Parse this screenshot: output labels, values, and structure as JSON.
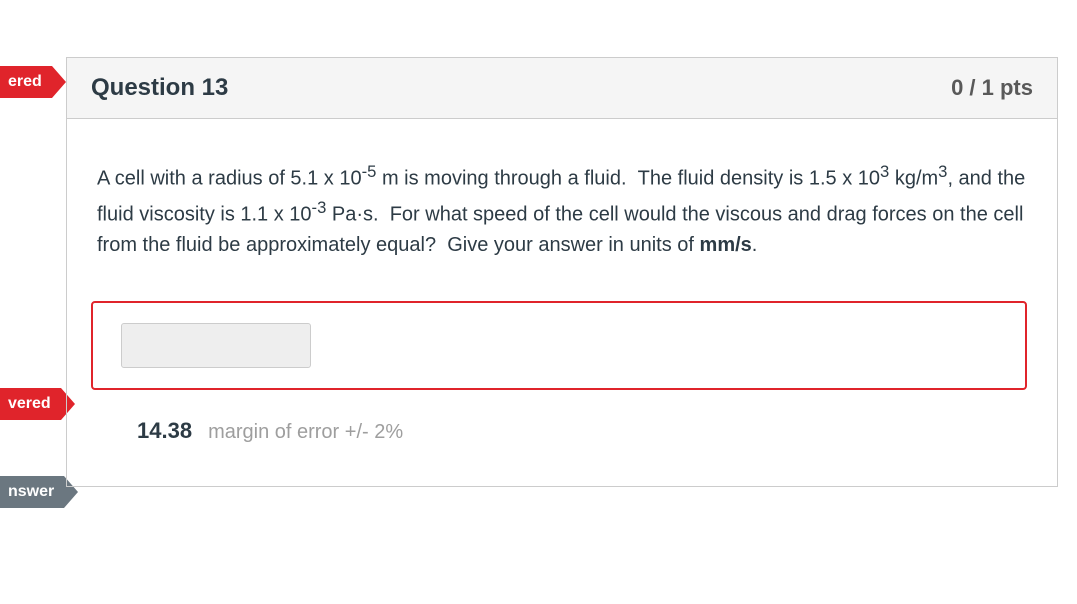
{
  "tags": {
    "unanswered_top": "ered",
    "unanswered_mid": "vered",
    "correct_answer": "nswer"
  },
  "question": {
    "title": "Question 13",
    "points": "0 / 1 pts",
    "text_plain": "A cell with a radius of 5.1 x 10⁻⁵ m is moving through a fluid.  The fluid density is 1.5 x 10³ kg/m³, and the fluid viscosity is 1.1 x 10⁻³ Pa·s.  For what speed of the cell would the viscous and drag forces on the cell from the fluid be approximately equal?  Give your answer in units of mm/s.",
    "user_answer": "",
    "correct_value": "14.38",
    "margin": "margin of error +/- 2%"
  }
}
